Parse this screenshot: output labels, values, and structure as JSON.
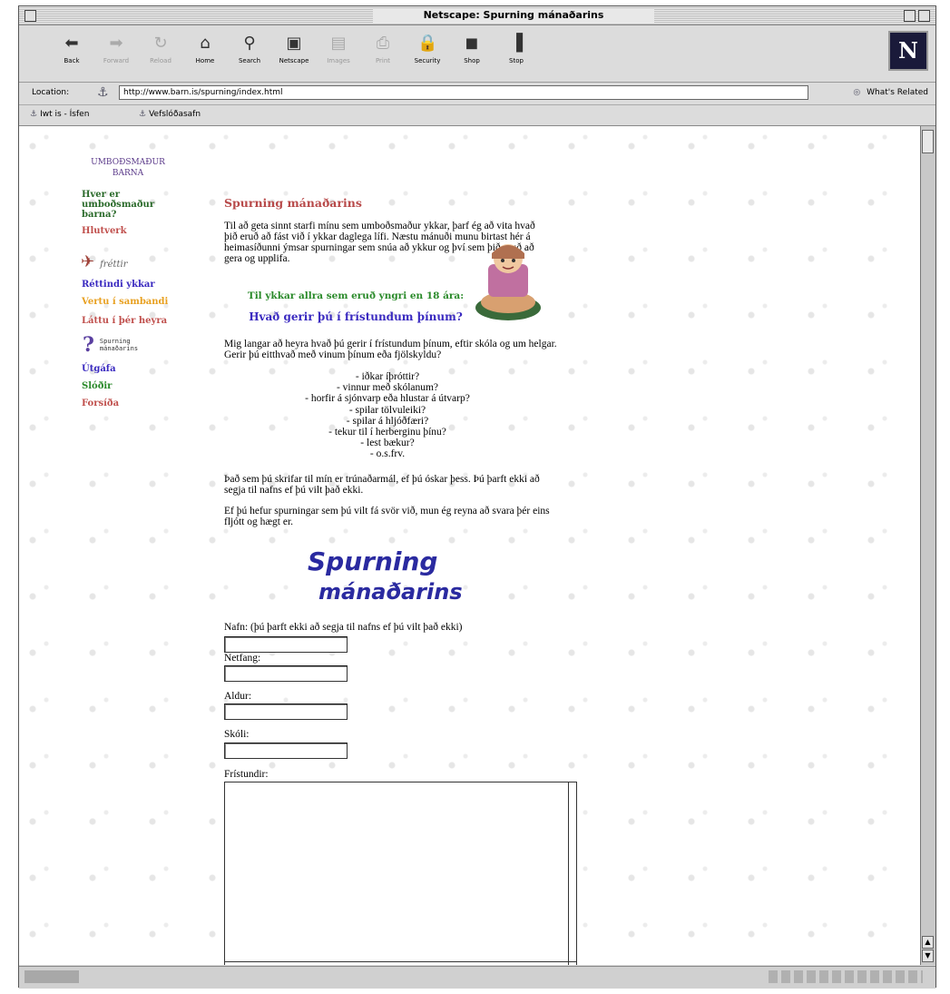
{
  "window": {
    "title": "Netscape: Spurning mánaðarins"
  },
  "toolbar": {
    "buttons": [
      {
        "label": "Back",
        "icon": "back-icon",
        "glyph": "⬅",
        "enabled": true
      },
      {
        "label": "Forward",
        "icon": "forward-icon",
        "glyph": "➡",
        "enabled": false
      },
      {
        "label": "Reload",
        "icon": "reload-icon",
        "glyph": "↻",
        "enabled": false
      },
      {
        "label": "Home",
        "icon": "home-icon",
        "glyph": "⌂",
        "enabled": true
      },
      {
        "label": "Search",
        "icon": "search-icon",
        "glyph": "⚲",
        "enabled": true
      },
      {
        "label": "Netscape",
        "icon": "netscape-icon",
        "glyph": "▣",
        "enabled": true
      },
      {
        "label": "Images",
        "icon": "images-icon",
        "glyph": "▤",
        "enabled": false
      },
      {
        "label": "Print",
        "icon": "print-icon",
        "glyph": "⎙",
        "enabled": false
      },
      {
        "label": "Security",
        "icon": "security-icon",
        "glyph": "🔒",
        "enabled": true
      },
      {
        "label": "Shop",
        "icon": "shop-icon",
        "glyph": "◼",
        "enabled": true
      },
      {
        "label": "Stop",
        "icon": "stop-icon",
        "glyph": "▐",
        "enabled": true
      }
    ],
    "logo": "N"
  },
  "location": {
    "label": "Location:",
    "url": "http://www.barn.is/spurning/index.html",
    "related": "What's Related"
  },
  "personal_toolbar": {
    "items": [
      "Iwt is - Ísfen",
      "Vefslóðasafn"
    ]
  },
  "sidebar": {
    "logo_line1": "Umboðsmaður",
    "logo_line2": "Barna",
    "nav": [
      {
        "label": "Hver er umboðsmaður barna?",
        "color": "#2a6a2a"
      },
      {
        "label": "Hlutverk",
        "color": "#c0504d"
      },
      {
        "label": "Réttindi ykkar",
        "color": "#3a2ac0"
      },
      {
        "label": "Vertu í sambandi",
        "color": "#e8a020"
      },
      {
        "label": "Láttu í þér heyra",
        "color": "#c0504d"
      },
      {
        "label": "Útgáfa",
        "color": "#3a2ac0"
      },
      {
        "label": "Slóðir",
        "color": "#2a8a2a"
      },
      {
        "label": "Forsíða",
        "color": "#c0504d"
      }
    ],
    "frettir": "fréttir",
    "spurning_line1": "Spurning",
    "spurning_line2": "mánaðarins"
  },
  "main": {
    "title": "Spurning mánaðarins",
    "intro": "Til að geta sinnt starfi mínu sem umboðsmaður ykkar, þarf ég að vita hvað þið eruð að fást við í ykkar daglega lífi. Næstu mánuði munu birtast hér á heimasíðunni ýmsar spurningar sem snúa að ykkur og því sem þið eruð að gera og upplifa.",
    "audience": "Til ykkar allra sem eruð yngri en 18 ára:",
    "question": "Hvað gerir þú í frístundum þínum?",
    "question_intro": "Mig langar að heyra hvað þú gerir í frístundum þínum, eftir skóla og um helgar. Gerir þú eitthvað með vinum þínum eða fjölskyldu?",
    "activities": [
      "- iðkar íþróttir?",
      "- vinnur með skólanum?",
      "- horfir á sjónvarp eða hlustar á útvarp?",
      "- spilar tölvuleiki?",
      "- spilar á hljóðfæri?",
      "- tekur til í herberginu þínu?",
      "- lest bækur?",
      "- o.s.frv."
    ],
    "confidential": "Það sem þú skrifar til mín er trúnaðarmál, ef þú óskar þess. Þú þarft ekki að segja til nafns ef þú vilt það ekki.",
    "contact": "Ef þú hefur spurningar sem þú vilt fá svör við, mun ég reyna að svara þér eins fljótt og hægt er.",
    "banner_line1": "Spurning",
    "banner_line2": "mánaðarins"
  },
  "form": {
    "name_label": "Nafn: (þú þarft ekki að segja til nafns ef þú vilt það ekki)",
    "email_label": "Netfang:",
    "age_label": "Aldur:",
    "school_label": "Skóli:",
    "hobbies_label": "Frístundir:",
    "name_value": "",
    "email_value": "",
    "age_value": "",
    "school_value": "",
    "hobbies_value": ""
  }
}
